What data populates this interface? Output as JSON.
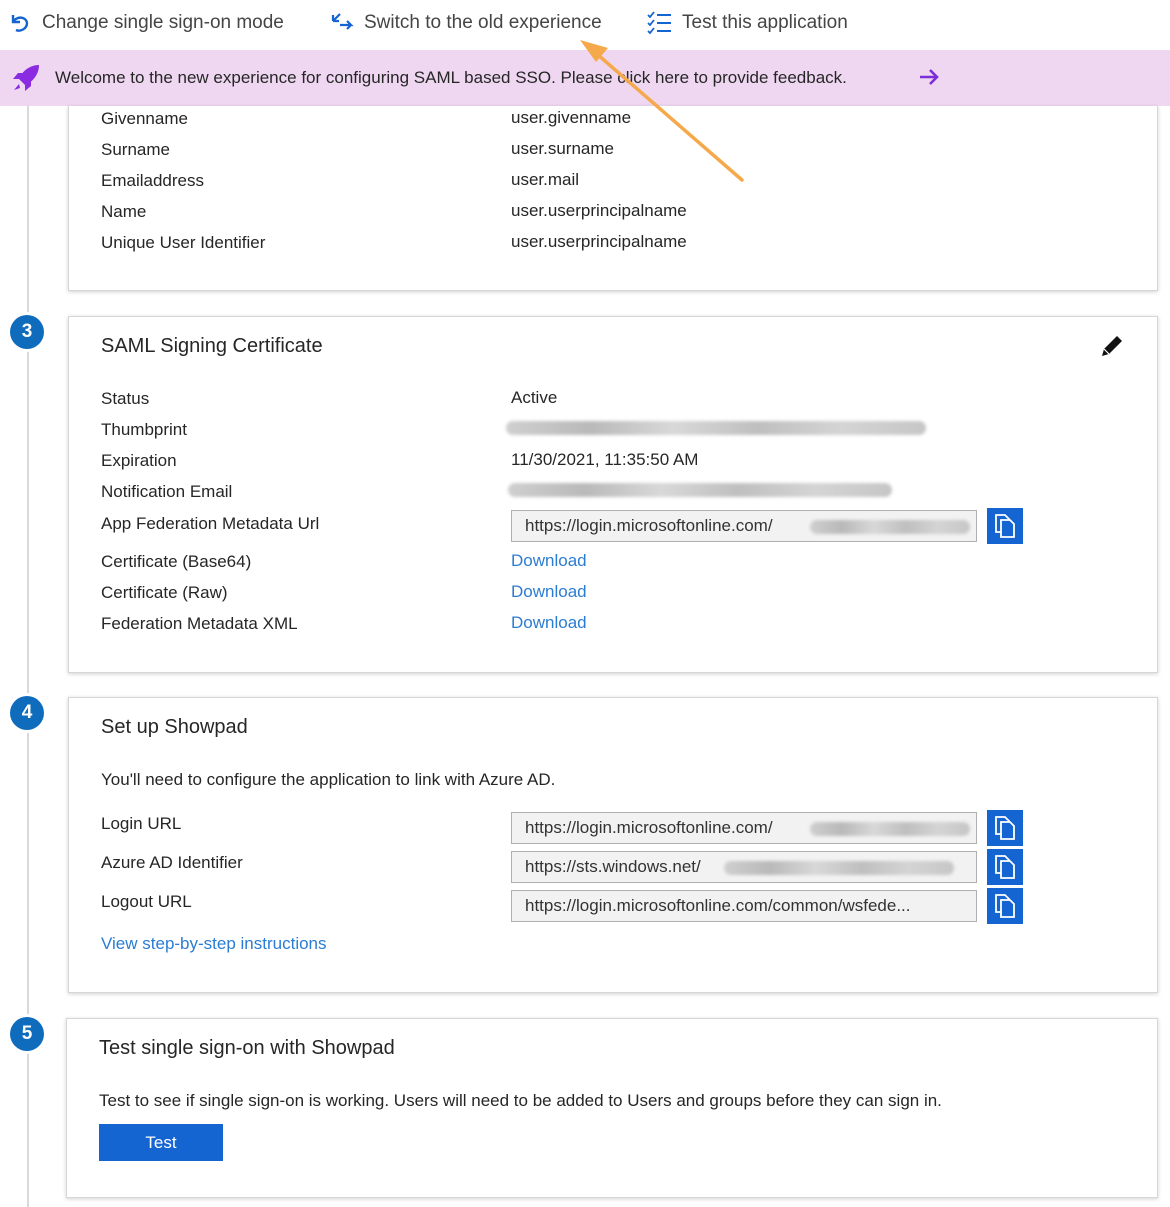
{
  "toolbar": {
    "change_mode": "Change single sign-on mode",
    "switch_old": "Switch to the old experience",
    "test_app": "Test this application"
  },
  "banner": {
    "message": "Welcome to the new experience for configuring SAML based SSO. Please click here to provide feedback."
  },
  "attributes": {
    "rows": [
      {
        "label": "Givenname",
        "value": "user.givenname"
      },
      {
        "label": "Surname",
        "value": "user.surname"
      },
      {
        "label": "Emailaddress",
        "value": "user.mail"
      },
      {
        "label": "Name",
        "value": "user.userprincipalname"
      },
      {
        "label": "Unique User Identifier",
        "value": "user.userprincipalname"
      }
    ]
  },
  "cert": {
    "step": "3",
    "title": "SAML Signing Certificate",
    "status_label": "Status",
    "status_value": "Active",
    "thumbprint_label": "Thumbprint",
    "expiration_label": "Expiration",
    "expiration_value": "11/30/2021, 11:35:50 AM",
    "notification_label": "Notification Email",
    "metadata_url_label": "App Federation Metadata Url",
    "metadata_url_value": "https://login.microsoftonline.com/",
    "base64_label": "Certificate (Base64)",
    "raw_label": "Certificate (Raw)",
    "fedxml_label": "Federation Metadata XML",
    "download": "Download"
  },
  "setup": {
    "step": "4",
    "title": "Set up Showpad",
    "desc": "You'll need to configure the application to link with Azure AD.",
    "login_label": "Login URL",
    "login_value": "https://login.microsoftonline.com/",
    "identifier_label": "Azure AD Identifier",
    "identifier_value": "https://sts.windows.net/",
    "logout_label": "Logout URL",
    "logout_value": "https://login.microsoftonline.com/common/wsfede...",
    "instructions": "View step-by-step instructions"
  },
  "test": {
    "step": "5",
    "title": "Test single sign-on with Showpad",
    "desc": "Test to see if single sign-on is working. Users will need to be added to Users and groups before they can sign in.",
    "button": "Test"
  },
  "colors": {
    "accent": "#1464d2",
    "link": "#2b7cd3",
    "banner": "#efd7f2",
    "annotation_arrow": "#f5a94a"
  }
}
